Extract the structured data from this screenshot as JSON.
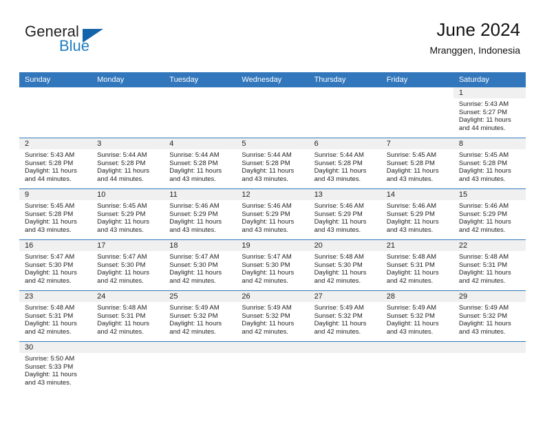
{
  "brand": {
    "name_top": "General",
    "name_bottom": "Blue",
    "color_dark": "#231f20",
    "color_blue": "#1f7dc0",
    "triangle_color": "#1464ab"
  },
  "header": {
    "title": "June 2024",
    "subtitle": "Mranggen, Indonesia",
    "accent_color": "#3277bc"
  },
  "weekday_headers": [
    "Sunday",
    "Monday",
    "Tuesday",
    "Wednesday",
    "Thursday",
    "Friday",
    "Saturday"
  ],
  "labels": {
    "sunrise_prefix": "Sunrise:",
    "sunset_prefix": "Sunset:",
    "daylight_prefix": "Daylight:"
  },
  "weeks": [
    [
      {
        "day": "",
        "blank": true
      },
      {
        "day": "",
        "blank": true
      },
      {
        "day": "",
        "blank": true
      },
      {
        "day": "",
        "blank": true
      },
      {
        "day": "",
        "blank": true
      },
      {
        "day": "",
        "blank": true
      },
      {
        "day": "1",
        "sunrise": "Sunrise: 5:43 AM",
        "sunset": "Sunset: 5:27 PM",
        "daylight_line1": "Daylight: 11 hours",
        "daylight_line2": "and 44 minutes."
      }
    ],
    [
      {
        "day": "2",
        "sunrise": "Sunrise: 5:43 AM",
        "sunset": "Sunset: 5:28 PM",
        "daylight_line1": "Daylight: 11 hours",
        "daylight_line2": "and 44 minutes."
      },
      {
        "day": "3",
        "sunrise": "Sunrise: 5:44 AM",
        "sunset": "Sunset: 5:28 PM",
        "daylight_line1": "Daylight: 11 hours",
        "daylight_line2": "and 44 minutes."
      },
      {
        "day": "4",
        "sunrise": "Sunrise: 5:44 AM",
        "sunset": "Sunset: 5:28 PM",
        "daylight_line1": "Daylight: 11 hours",
        "daylight_line2": "and 43 minutes."
      },
      {
        "day": "5",
        "sunrise": "Sunrise: 5:44 AM",
        "sunset": "Sunset: 5:28 PM",
        "daylight_line1": "Daylight: 11 hours",
        "daylight_line2": "and 43 minutes."
      },
      {
        "day": "6",
        "sunrise": "Sunrise: 5:44 AM",
        "sunset": "Sunset: 5:28 PM",
        "daylight_line1": "Daylight: 11 hours",
        "daylight_line2": "and 43 minutes."
      },
      {
        "day": "7",
        "sunrise": "Sunrise: 5:45 AM",
        "sunset": "Sunset: 5:28 PM",
        "daylight_line1": "Daylight: 11 hours",
        "daylight_line2": "and 43 minutes."
      },
      {
        "day": "8",
        "sunrise": "Sunrise: 5:45 AM",
        "sunset": "Sunset: 5:28 PM",
        "daylight_line1": "Daylight: 11 hours",
        "daylight_line2": "and 43 minutes."
      }
    ],
    [
      {
        "day": "9",
        "sunrise": "Sunrise: 5:45 AM",
        "sunset": "Sunset: 5:28 PM",
        "daylight_line1": "Daylight: 11 hours",
        "daylight_line2": "and 43 minutes."
      },
      {
        "day": "10",
        "sunrise": "Sunrise: 5:45 AM",
        "sunset": "Sunset: 5:29 PM",
        "daylight_line1": "Daylight: 11 hours",
        "daylight_line2": "and 43 minutes."
      },
      {
        "day": "11",
        "sunrise": "Sunrise: 5:46 AM",
        "sunset": "Sunset: 5:29 PM",
        "daylight_line1": "Daylight: 11 hours",
        "daylight_line2": "and 43 minutes."
      },
      {
        "day": "12",
        "sunrise": "Sunrise: 5:46 AM",
        "sunset": "Sunset: 5:29 PM",
        "daylight_line1": "Daylight: 11 hours",
        "daylight_line2": "and 43 minutes."
      },
      {
        "day": "13",
        "sunrise": "Sunrise: 5:46 AM",
        "sunset": "Sunset: 5:29 PM",
        "daylight_line1": "Daylight: 11 hours",
        "daylight_line2": "and 43 minutes."
      },
      {
        "day": "14",
        "sunrise": "Sunrise: 5:46 AM",
        "sunset": "Sunset: 5:29 PM",
        "daylight_line1": "Daylight: 11 hours",
        "daylight_line2": "and 43 minutes."
      },
      {
        "day": "15",
        "sunrise": "Sunrise: 5:46 AM",
        "sunset": "Sunset: 5:29 PM",
        "daylight_line1": "Daylight: 11 hours",
        "daylight_line2": "and 42 minutes."
      }
    ],
    [
      {
        "day": "16",
        "sunrise": "Sunrise: 5:47 AM",
        "sunset": "Sunset: 5:30 PM",
        "daylight_line1": "Daylight: 11 hours",
        "daylight_line2": "and 42 minutes."
      },
      {
        "day": "17",
        "sunrise": "Sunrise: 5:47 AM",
        "sunset": "Sunset: 5:30 PM",
        "daylight_line1": "Daylight: 11 hours",
        "daylight_line2": "and 42 minutes."
      },
      {
        "day": "18",
        "sunrise": "Sunrise: 5:47 AM",
        "sunset": "Sunset: 5:30 PM",
        "daylight_line1": "Daylight: 11 hours",
        "daylight_line2": "and 42 minutes."
      },
      {
        "day": "19",
        "sunrise": "Sunrise: 5:47 AM",
        "sunset": "Sunset: 5:30 PM",
        "daylight_line1": "Daylight: 11 hours",
        "daylight_line2": "and 42 minutes."
      },
      {
        "day": "20",
        "sunrise": "Sunrise: 5:48 AM",
        "sunset": "Sunset: 5:30 PM",
        "daylight_line1": "Daylight: 11 hours",
        "daylight_line2": "and 42 minutes."
      },
      {
        "day": "21",
        "sunrise": "Sunrise: 5:48 AM",
        "sunset": "Sunset: 5:31 PM",
        "daylight_line1": "Daylight: 11 hours",
        "daylight_line2": "and 42 minutes."
      },
      {
        "day": "22",
        "sunrise": "Sunrise: 5:48 AM",
        "sunset": "Sunset: 5:31 PM",
        "daylight_line1": "Daylight: 11 hours",
        "daylight_line2": "and 42 minutes."
      }
    ],
    [
      {
        "day": "23",
        "sunrise": "Sunrise: 5:48 AM",
        "sunset": "Sunset: 5:31 PM",
        "daylight_line1": "Daylight: 11 hours",
        "daylight_line2": "and 42 minutes."
      },
      {
        "day": "24",
        "sunrise": "Sunrise: 5:48 AM",
        "sunset": "Sunset: 5:31 PM",
        "daylight_line1": "Daylight: 11 hours",
        "daylight_line2": "and 42 minutes."
      },
      {
        "day": "25",
        "sunrise": "Sunrise: 5:49 AM",
        "sunset": "Sunset: 5:32 PM",
        "daylight_line1": "Daylight: 11 hours",
        "daylight_line2": "and 42 minutes."
      },
      {
        "day": "26",
        "sunrise": "Sunrise: 5:49 AM",
        "sunset": "Sunset: 5:32 PM",
        "daylight_line1": "Daylight: 11 hours",
        "daylight_line2": "and 42 minutes."
      },
      {
        "day": "27",
        "sunrise": "Sunrise: 5:49 AM",
        "sunset": "Sunset: 5:32 PM",
        "daylight_line1": "Daylight: 11 hours",
        "daylight_line2": "and 42 minutes."
      },
      {
        "day": "28",
        "sunrise": "Sunrise: 5:49 AM",
        "sunset": "Sunset: 5:32 PM",
        "daylight_line1": "Daylight: 11 hours",
        "daylight_line2": "and 43 minutes."
      },
      {
        "day": "29",
        "sunrise": "Sunrise: 5:49 AM",
        "sunset": "Sunset: 5:32 PM",
        "daylight_line1": "Daylight: 11 hours",
        "daylight_line2": "and 43 minutes."
      }
    ],
    [
      {
        "day": "30",
        "sunrise": "Sunrise: 5:50 AM",
        "sunset": "Sunset: 5:33 PM",
        "daylight_line1": "Daylight: 11 hours",
        "daylight_line2": "and 43 minutes."
      },
      {
        "day": "",
        "empty": true
      },
      {
        "day": "",
        "empty": true
      },
      {
        "day": "",
        "empty": true
      },
      {
        "day": "",
        "empty": true
      },
      {
        "day": "",
        "empty": true
      },
      {
        "day": "",
        "empty": true
      }
    ]
  ]
}
